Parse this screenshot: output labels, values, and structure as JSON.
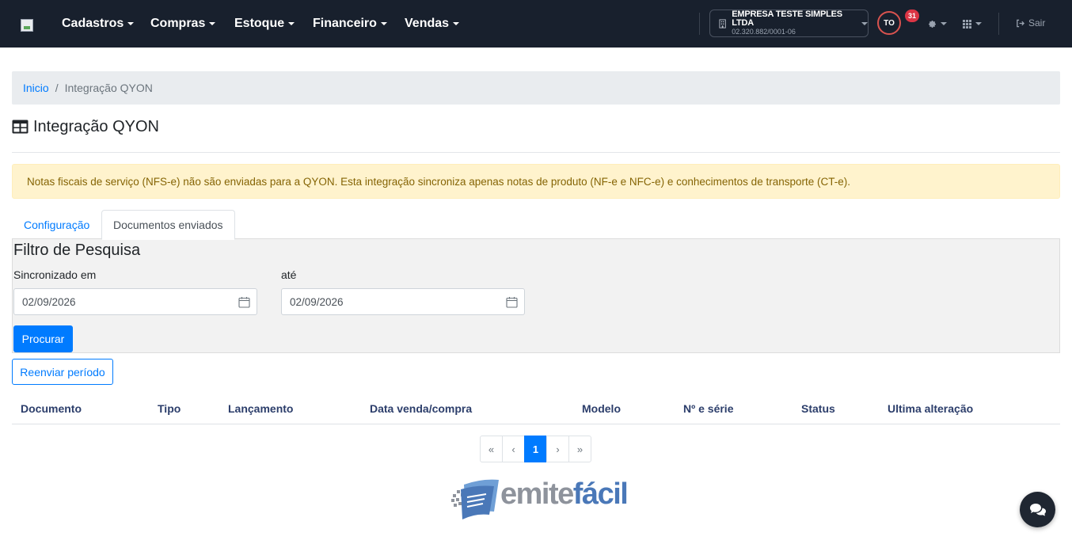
{
  "nav": {
    "items": [
      {
        "label": "Cadastros"
      },
      {
        "label": "Compras"
      },
      {
        "label": "Estoque"
      },
      {
        "label": "Financeiro"
      },
      {
        "label": "Vendas"
      }
    ],
    "company_name": "EMPRESA TESTE SIMPLES LTDA",
    "company_cnpj": "02.320.882/0001-06",
    "avatar_initials": "TO",
    "notification_count": "31",
    "logout_label": "Sair"
  },
  "breadcrumb": {
    "home": "Inicio",
    "separator": "/",
    "current": "Integração QYON"
  },
  "page_title": "Integração QYON",
  "alert_text": "Notas fiscais de serviço (NFS-e) não são enviadas para a QYON. Esta integração sincroniza apenas notas de produto (NF-e e NFC-e) e conhecimentos de transporte (CT-e).",
  "tabs": [
    {
      "label": "Configuração"
    },
    {
      "label": "Documentos enviados"
    }
  ],
  "filter": {
    "title": "Filtro de Pesquisa",
    "from_label": "Sincronizado em",
    "from_value": "02/09/2026",
    "to_label": "até",
    "to_value": "02/09/2026",
    "search_label": "Procurar"
  },
  "resend_label": "Reenviar período",
  "table": {
    "columns": [
      "Documento",
      "Tipo",
      "Lançamento",
      "Data venda/compra",
      "Modelo",
      "Nº e série",
      "Status",
      "Ultima alteração"
    ]
  },
  "pagination": {
    "first": "«",
    "prev": "‹",
    "current": "1",
    "next": "›",
    "last": "»"
  },
  "footer_logo": {
    "part1": "emite",
    "part2": "fácil"
  },
  "colors": {
    "navbar": "#18202d",
    "primary": "#007bff",
    "alert_bg": "#fff3cd",
    "alert_text": "#856404",
    "badge": "#dc3545"
  }
}
